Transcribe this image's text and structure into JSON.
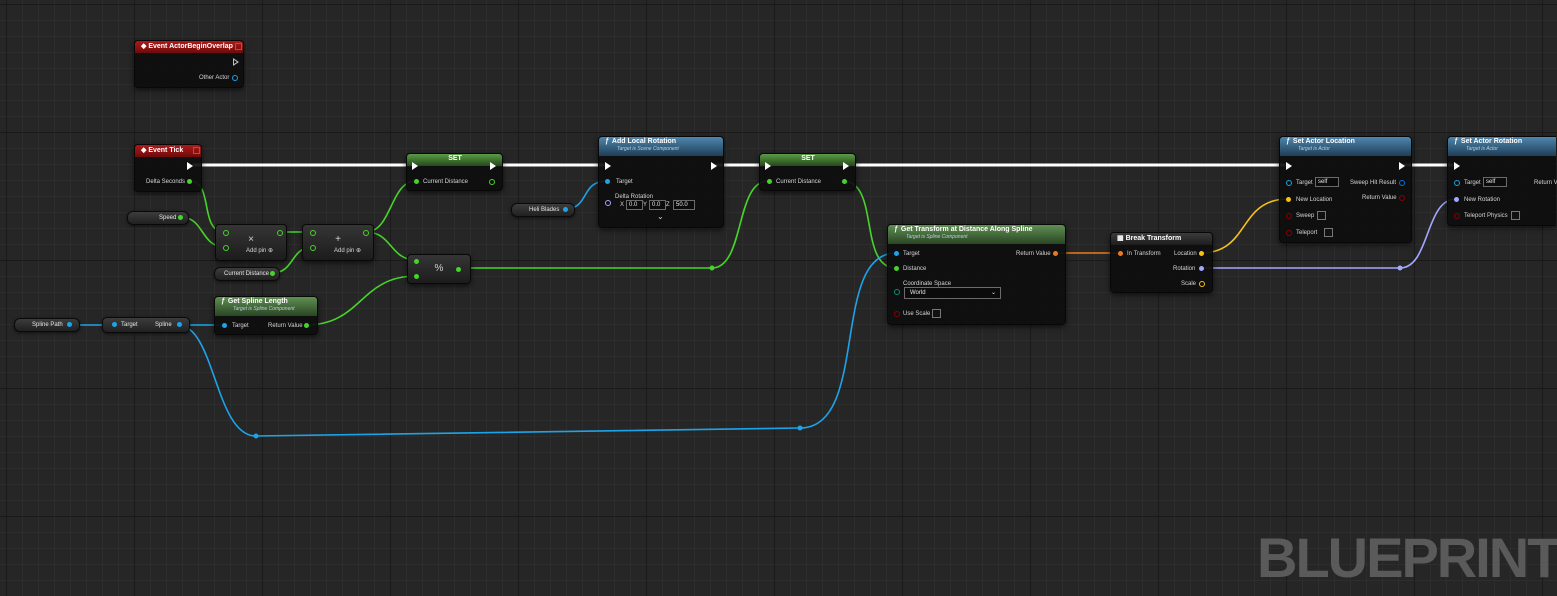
{
  "colors": {
    "exec": "#ffffff",
    "float": "#46d42a",
    "object": "#1da4e8",
    "struct_transform": "#f0791a",
    "vector": "#f5c21a",
    "rotator": "#a3a8ff",
    "bool": "#8a0000",
    "pure_node_header": "#4f86ad",
    "event_header": "#b11919"
  },
  "nodes": {
    "begin_overlap": {
      "title": "Event ActorBeginOverlap",
      "pin_other_actor": "Other Actor"
    },
    "event_tick": {
      "title": "Event Tick",
      "pin_delta": "Delta Seconds"
    },
    "speed": {
      "label": "Speed"
    },
    "current_distance_get": {
      "label": "Current Distance"
    },
    "multiply": {
      "symbol": "×",
      "add_pin": "Add pin"
    },
    "add": {
      "symbol": "+",
      "add_pin": "Add pin"
    },
    "set1": {
      "title": "SET",
      "pin": "Current Distance"
    },
    "modulo": {
      "symbol": "%"
    },
    "heli_blades": {
      "label": "Heli Blades"
    },
    "add_local_rotation": {
      "title": "Add Local Rotation",
      "subtitle": "Target is Scene Component",
      "pin_target": "Target",
      "pin_delta": "Delta Rotation",
      "x_label": "X",
      "x_val": "0.0",
      "y_label": "Y",
      "y_val": "0.0",
      "z_label": "Z",
      "z_val": "50.0",
      "expand": "⌄"
    },
    "set2": {
      "title": "SET",
      "pin": "Current Distance"
    },
    "spline_path": {
      "label": "Spline Path"
    },
    "get_spline": {
      "pin_target": "Target",
      "pin_spline": "Spline"
    },
    "get_spline_length": {
      "title": "Get Spline Length",
      "subtitle": "Target is Spline Component",
      "pin_target": "Target",
      "pin_return": "Return Value"
    },
    "get_transform": {
      "title": "Get Transform at Distance Along Spline",
      "subtitle": "Target is Spline Component",
      "pin_target": "Target",
      "pin_distance": "Distance",
      "pin_coord": "Coordinate Space",
      "coord_value": "World",
      "pin_use_scale": "Use Scale",
      "pin_return": "Return Value"
    },
    "break_transform": {
      "title": "Break Transform",
      "pin_in": "In Transform",
      "pin_location": "Location",
      "pin_rotation": "Rotation",
      "pin_scale": "Scale"
    },
    "set_actor_location": {
      "title": "Set Actor Location",
      "subtitle": "Target is Actor",
      "pin_target": "Target",
      "target_value": "self",
      "pin_new_location": "New Location",
      "pin_sweep": "Sweep",
      "pin_teleport": "Teleport",
      "pin_sweep_hit": "Sweep Hit Result",
      "pin_return": "Return Value"
    },
    "set_actor_rotation": {
      "title": "Set Actor Rotation",
      "subtitle": "Target is Actor",
      "pin_target": "Target",
      "target_value": "self",
      "pin_new_rotation": "New Rotation",
      "pin_teleport": "Teleport Physics",
      "pin_return": "Return Va"
    }
  },
  "watermark": "BLUEPRINT"
}
